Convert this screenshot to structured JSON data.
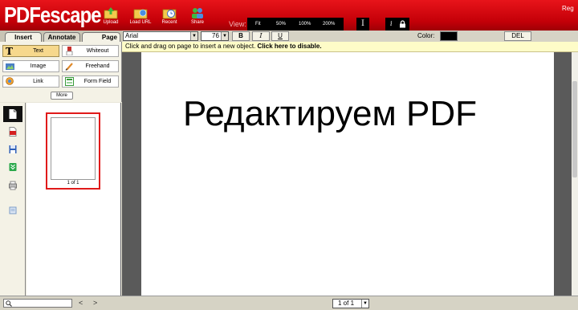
{
  "app": {
    "logo": "PDFescape",
    "top_right": "Reg"
  },
  "toolbar": {
    "buttons": [
      {
        "label": "Upload",
        "icon": "upload-icon"
      },
      {
        "label": "Load URL",
        "icon": "load-url-icon"
      },
      {
        "label": "Recent",
        "icon": "recent-icon"
      },
      {
        "label": "Share",
        "icon": "share-icon"
      }
    ],
    "view_label": "View:",
    "zoom_options": [
      "Fit",
      "50%",
      "100%",
      "200%"
    ],
    "text_tool_glyph": "I",
    "info_glyph": "i"
  },
  "tabs": [
    "Insert",
    "Annotate",
    "Page"
  ],
  "format": {
    "font": "Arial",
    "size": "76",
    "bold": "B",
    "italic": "I",
    "underline": "U",
    "color_label": "Color:",
    "color_value": "#000000",
    "delete_label": "DEL"
  },
  "tools": [
    {
      "label": "Text",
      "icon": "text-tool-icon",
      "active": true
    },
    {
      "label": "Whiteout",
      "icon": "whiteout-icon",
      "active": false
    },
    {
      "label": "Image",
      "icon": "image-icon",
      "active": false
    },
    {
      "label": "Freehand",
      "icon": "freehand-icon",
      "active": false
    },
    {
      "label": "Link",
      "icon": "link-icon",
      "active": false
    },
    {
      "label": "Form Field",
      "icon": "form-field-icon",
      "active": false
    }
  ],
  "more_label": "More",
  "instruction": {
    "text": "Click and drag on page to insert a new object. ",
    "link": "Click here to disable."
  },
  "side_icons": [
    "page-icon",
    "pdf-document-icon",
    "save-icon",
    "download-icon",
    "print-icon",
    "form-icon"
  ],
  "thumbnail": {
    "label": "1 of 1"
  },
  "document": {
    "text": "Редактируем PDF"
  },
  "bottom": {
    "prev": "<",
    "next": ">",
    "page_select": "1 of 1"
  },
  "colors": {
    "header_red": "#c40008",
    "active_tool": "#f6d88c",
    "instruction_bg": "#fefcc8",
    "thumbnail_border": "#e01a1a"
  }
}
